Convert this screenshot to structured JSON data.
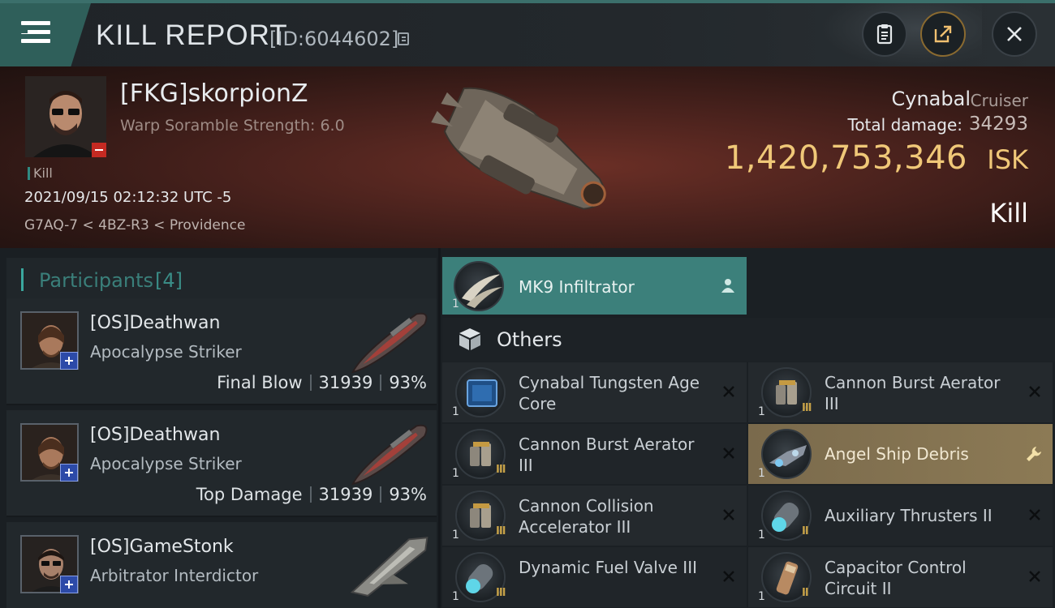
{
  "header": {
    "title": "KILL REPORT",
    "report_id": "[ID:6044602]"
  },
  "victim": {
    "name": "[FKG]skorpionZ",
    "subtitle": "Warp Soramble Strength: 6.0",
    "tag": "Kill",
    "datetime": "2021/09/15 02:12:32 UTC -5",
    "location": "G7AQ-7 < 4BZ-R3 < Providence",
    "ship_name": "Cynabal",
    "ship_class": "Cruiser",
    "damage_label": "Total damage:",
    "damage_value": "34293",
    "isk_value": "1,420,753,346",
    "isk_label": "ISK",
    "result": "Kill"
  },
  "participants": {
    "title": "Participants",
    "count": "[4]",
    "rows": [
      {
        "name": "[OS]Deathwan",
        "ship": "Apocalypse Striker",
        "role": "Final Blow",
        "damage": "31939",
        "percent": "93%"
      },
      {
        "name": "[OS]Deathwan",
        "ship": "Apocalypse Striker",
        "role": "Top Damage",
        "damage": "31939",
        "percent": "93%"
      },
      {
        "name": "[OS]GameStonk",
        "ship": "Arbitrator Interdictor"
      }
    ]
  },
  "implant": {
    "qty": "1",
    "name": "MK9  Infiltrator"
  },
  "others": {
    "title": "Others",
    "items": [
      {
        "qty": "1",
        "name": "Cynabal Tungsten Age Core",
        "tier": ""
      },
      {
        "qty": "1",
        "name": "Cannon Burst Aerator III",
        "tier": "III"
      },
      {
        "qty": "1",
        "name": "Cannon Burst Aerator III",
        "tier": "III"
      },
      {
        "qty": "1",
        "name": "Angel Ship Debris",
        "tier": ""
      },
      {
        "qty": "1",
        "name": "Cannon Collision Accelerator III",
        "tier": "III"
      },
      {
        "qty": "1",
        "name": "Auxiliary Thrusters II",
        "tier": "II"
      },
      {
        "qty": "1",
        "name": "Dynamic Fuel Valve III",
        "tier": "III"
      },
      {
        "qty": "1",
        "name": "Capacitor Control Circuit II",
        "tier": "II"
      }
    ]
  },
  "colors": {
    "accent": "#3c807b",
    "isk_gold": "#f0c878",
    "highlight": "#8c7a55",
    "banner_red": "#6b2f26"
  }
}
